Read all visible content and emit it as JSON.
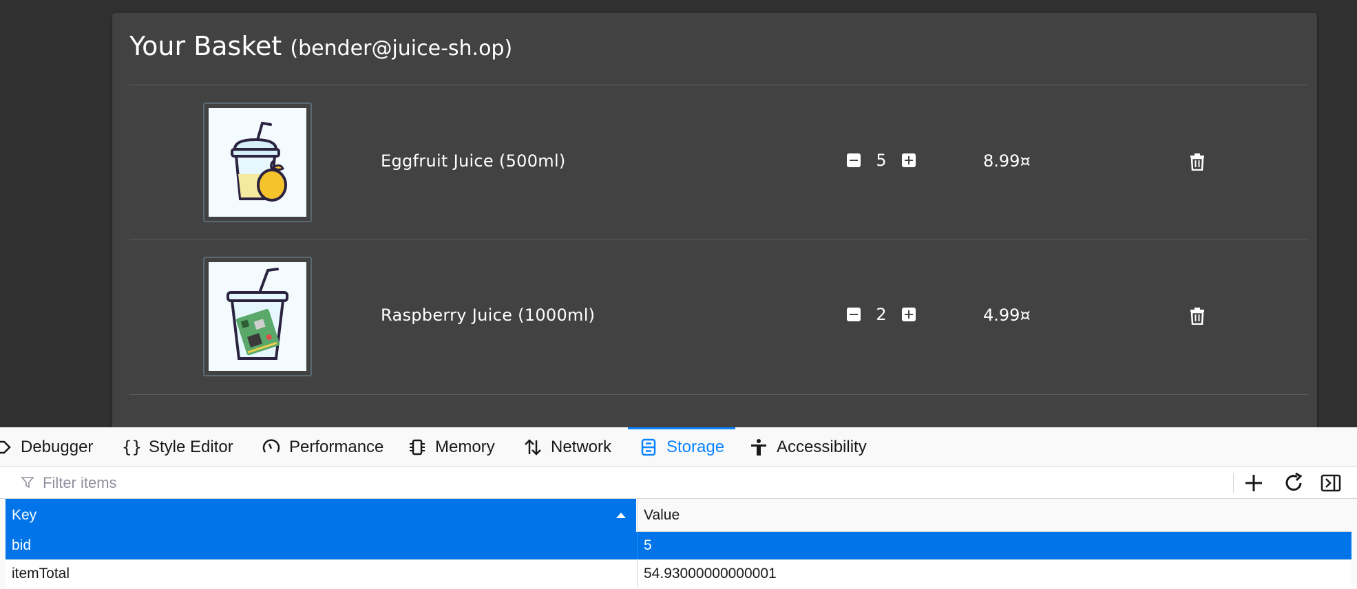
{
  "basket": {
    "title": "Your Basket",
    "user": "(bender@juice-sh.op)",
    "items": [
      {
        "name": "Eggfruit Juice (500ml)",
        "quantity": "5",
        "price": "8.99¤"
      },
      {
        "name": "Raspberry Juice (1000ml)",
        "quantity": "2",
        "price": "4.99¤"
      }
    ]
  },
  "devtools": {
    "tabs": [
      {
        "label": "Debugger",
        "icon": "debugger-icon"
      },
      {
        "label": "Style Editor",
        "icon": "braces-icon"
      },
      {
        "label": "Performance",
        "icon": "gauge-icon"
      },
      {
        "label": "Memory",
        "icon": "chip-icon"
      },
      {
        "label": "Network",
        "icon": "arrows-updown-icon"
      },
      {
        "label": "Storage",
        "icon": "storage-icon"
      },
      {
        "label": "Accessibility",
        "icon": "accessibility-icon"
      }
    ],
    "selected_tab": "Storage",
    "accent": "#0a84ff",
    "filter_placeholder": "Filter items",
    "table": {
      "headers": {
        "key": "Key",
        "value": "Value"
      },
      "rows": [
        {
          "key": "bid",
          "value": "5"
        },
        {
          "key": "itemTotal",
          "value": "54.93000000000001"
        }
      ]
    }
  }
}
